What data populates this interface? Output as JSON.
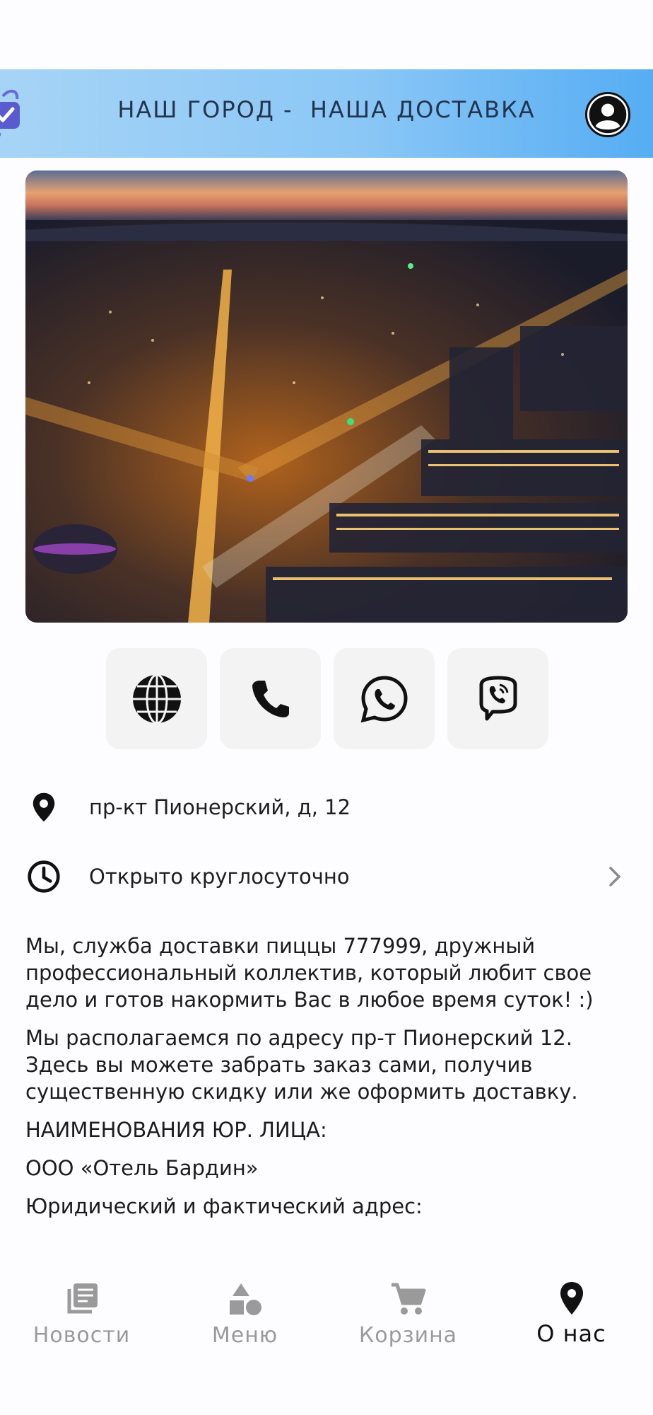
{
  "header": {
    "title": "НАШ ГОРОД -  НАША ДОСТАВКА",
    "logo_icon": "shopping-basket-check-icon",
    "account_icon": "account-circle-icon"
  },
  "hero": {
    "image": "night-city-aerial-photo"
  },
  "contacts": [
    {
      "icon": "globe-icon"
    },
    {
      "icon": "phone-icon"
    },
    {
      "icon": "whatsapp-icon"
    },
    {
      "icon": "viber-icon"
    }
  ],
  "address": {
    "icon": "location-pin-icon",
    "text": "пр-кт Пионерский, д, 12"
  },
  "hours": {
    "icon": "clock-icon",
    "text": "Открыто круглосуточно",
    "chevron": "chevron-right-icon"
  },
  "about": {
    "paragraph1": "Мы, служба доставки пиццы 777999, дружный профессиональный коллектив, который любит свое дело и готов накормить Вас в любое время суток! :)",
    "paragraph2": "Мы располагаемся по адресу пр-т Пионерский 12. Здесь вы можете забрать заказ сами, получив существенную скидку или же оформить доставку.",
    "legal_heading": "НАИМЕНОВАНИЯ ЮР. ЛИЦА:",
    "legal_name": "ООО «Отель Бардин»",
    "address_heading": "Юридический и фактический адрес:"
  },
  "nav": [
    {
      "label": "Новости",
      "icon": "news-icon",
      "active": false
    },
    {
      "label": "Меню",
      "icon": "shapes-icon",
      "active": false
    },
    {
      "label": "Корзина",
      "icon": "cart-icon",
      "active": false
    },
    {
      "label": "О нас",
      "icon": "location-pin-icon",
      "active": true
    }
  ],
  "colors": {
    "header_start": "#a6d4f6",
    "header_end": "#55adf3",
    "nav_inactive": "#9a9a9a",
    "nav_active": "#111111",
    "button_bg": "#f3f3f3"
  }
}
